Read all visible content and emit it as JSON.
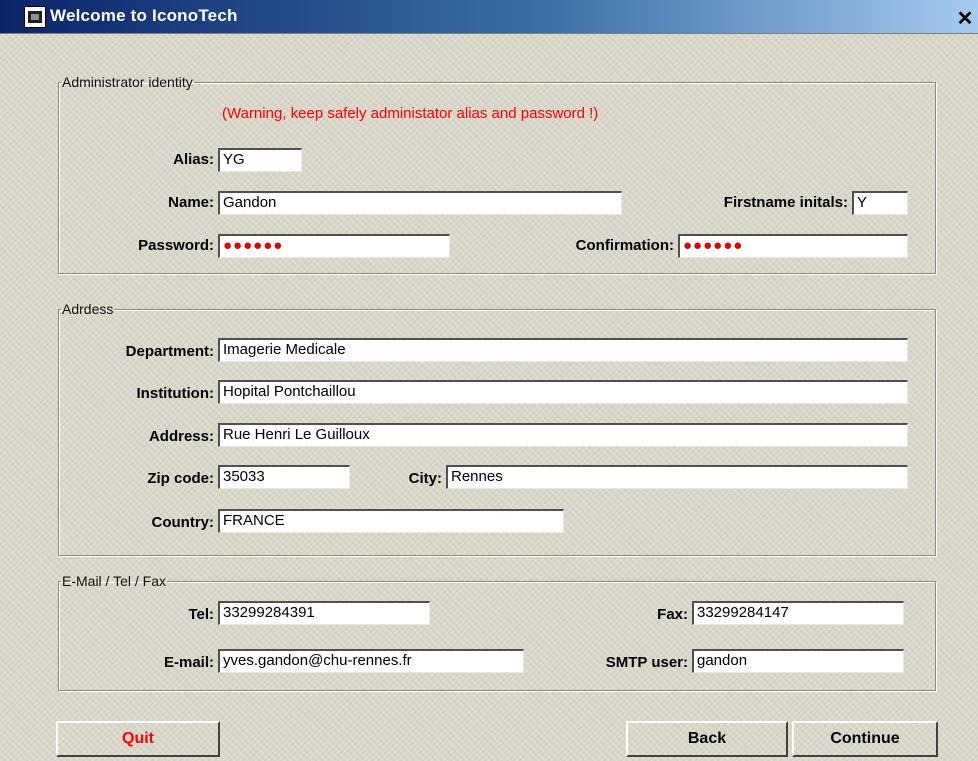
{
  "window": {
    "title": "Welcome to IconoTech",
    "close_glyph": "✕"
  },
  "admin": {
    "legend": "Administrator identity",
    "warning": "(Warning, keep safely administator alias and password !)",
    "alias_label": "Alias:",
    "alias_value": "YG",
    "name_label": "Name:",
    "name_value": "Gandon",
    "initials_label": "Firstname initals:",
    "initials_value": "Y",
    "password_label": "Password:",
    "password_value": "●●●●●●",
    "confirmation_label": "Confirmation:",
    "confirmation_value": "●●●●●●"
  },
  "address": {
    "legend": "Adrdess",
    "department_label": "Department:",
    "department_value": "Imagerie Medicale",
    "institution_label": "Institution:",
    "institution_value": "Hopital Pontchaillou",
    "address_label": "Address:",
    "address_value": "Rue Henri Le Guilloux",
    "zip_label": "Zip code:",
    "zip_value": "35033",
    "city_label": "City:",
    "city_value": "Rennes",
    "country_label": "Country:",
    "country_value": "FRANCE"
  },
  "contact": {
    "legend": "E-Mail / Tel / Fax",
    "tel_label": "Tel:",
    "tel_value": "33299284391",
    "fax_label": "Fax:",
    "fax_value": "33299284147",
    "email_label": "E-mail:",
    "email_value": "yves.gandon@chu-rennes.fr",
    "smtp_label": "SMTP user:",
    "smtp_value": "gandon"
  },
  "buttons": {
    "quit": "Quit",
    "back": "Back",
    "continue": "Continue"
  },
  "colors": {
    "quit_text": "#ff0000",
    "warning_text": "#ff0000",
    "password_dots": "#e00000"
  }
}
